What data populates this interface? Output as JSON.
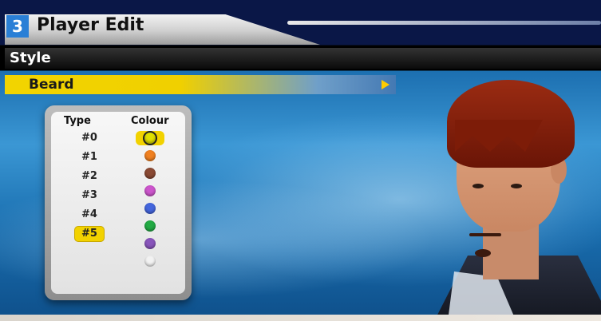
{
  "header": {
    "step_number": "3",
    "title": "Player Edit"
  },
  "section": {
    "label": "Style"
  },
  "selector": {
    "label": "Beard"
  },
  "panel": {
    "type_header": "Type",
    "colour_header": "Colour",
    "types": [
      "#0",
      "#1",
      "#2",
      "#3",
      "#4",
      "#5"
    ],
    "selected_type_index": 5,
    "colours": [
      "#e0e000",
      "#f08020",
      "#8a4a34",
      "#cc55cc",
      "#4466dd",
      "#22aa44",
      "#8855bb",
      "#f2f2f2"
    ],
    "selected_colour_index": 0
  },
  "colors": {
    "accent_yellow": "#f2d200",
    "title_badge_blue": "#2a7fd6"
  }
}
